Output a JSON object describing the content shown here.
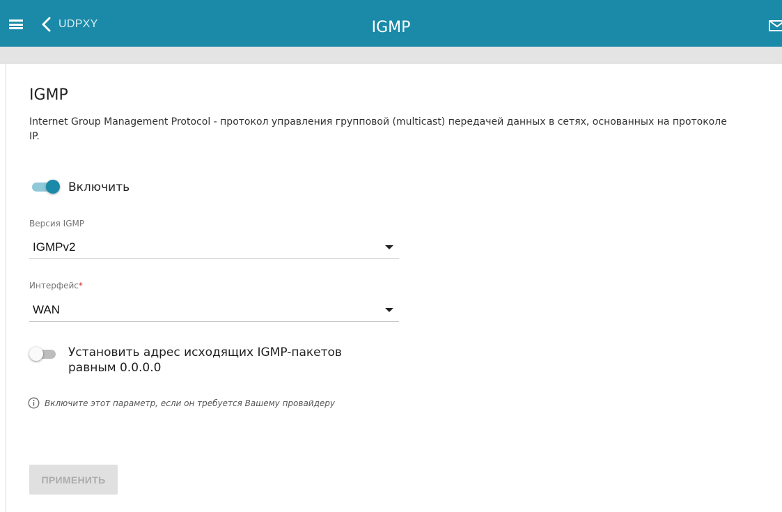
{
  "header": {
    "back_label": "UDPXY",
    "title": "IGMP",
    "icons": {
      "menu": "hamburger-menu-icon",
      "back": "chevron-left-icon",
      "mail": "mail-icon"
    },
    "bar_color": "#1a8aa8"
  },
  "main": {
    "section_title": "IGMP",
    "description": "Internet Group Management Protocol - протокол управления групповой (multicast) передачей данных в сетях, основанных на протоколе IP.",
    "enable": {
      "label": "Включить",
      "state": "on"
    },
    "igmp_version": {
      "label": "Версия IGMP",
      "value": "IGMPv2"
    },
    "interface": {
      "label": "Интерфейс",
      "required_mark": "*",
      "value": "WAN"
    },
    "zero_address": {
      "label_line1": "Установить адрес исходящих IGMP-пакетов",
      "label_line2": "равным 0.0.0.0",
      "state": "off"
    },
    "hint": {
      "icon": "info-icon",
      "text": "Включите этот параметр, если он требуется Вашему провайдеру"
    },
    "apply_button": {
      "label": "ПРИМЕНИТЬ",
      "state": "disabled"
    }
  }
}
